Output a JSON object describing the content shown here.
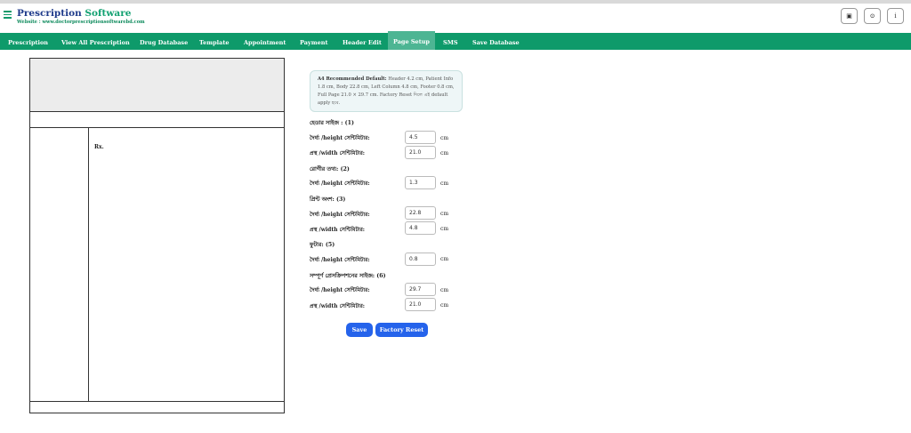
{
  "brand": {
    "name_part1": "Prescription",
    "name_part2": "Software",
    "website": "Website : www.doctorprescriptionsoftwarebd.com"
  },
  "header_buttons": [
    {
      "icon": "document-icon",
      "glyph": "▣"
    },
    {
      "icon": "help-icon",
      "glyph": "⊙"
    },
    {
      "icon": "user-icon",
      "glyph": "ⅰ"
    }
  ],
  "nav": {
    "items": [
      {
        "label": "Prescription"
      },
      {
        "label": "View All Prescription"
      },
      {
        "label": "Drug Database"
      },
      {
        "label": "Template"
      },
      {
        "label": "Appointment"
      },
      {
        "label": "Payment"
      },
      {
        "label": "Header Edit"
      },
      {
        "label": "Page Setup",
        "active": true
      },
      {
        "label": "SMS"
      },
      {
        "label": "Save Database"
      }
    ]
  },
  "preview": {
    "rx_label": "Rx."
  },
  "info": {
    "title": "A4 Recommended Default:",
    "text": "Header 4.2 cm, Patient Info 1.8 cm, Body 22.8 cm, Left Column 4.8 cm, Footer 0.8 cm, Full Page 21.0 × 29.7 cm. Factory Reset দিলে এই default apply হবে."
  },
  "form": {
    "unit": "cm",
    "sections": [
      {
        "title": "হেডার সাইজ : (1)",
        "fields": [
          {
            "label": "দৈর্ঘ্য /height সেন্টিমিটার:",
            "value": "4.5"
          },
          {
            "label": "প্রস্থ /width সেন্টিমিটার:",
            "value": "21.0"
          }
        ]
      },
      {
        "title": "রোগীর তথ্য: (2)",
        "fields": [
          {
            "label": "দৈর্ঘ্য /height সেন্টিমিটার:",
            "value": "1.3"
          }
        ]
      },
      {
        "title": "প্রিন্ট অংশ: (3)",
        "fields": [
          {
            "label": "দৈর্ঘ্য /height সেন্টিমিটার:",
            "value": "22.8"
          },
          {
            "label": "প্রস্থ /width সেন্টিমিটার:",
            "value": "4.8"
          }
        ]
      },
      {
        "title": "ফুটার: (5)",
        "fields": [
          {
            "label": "দৈর্ঘ্য /height সেন্টিমিটার:",
            "value": "0.8"
          }
        ]
      },
      {
        "title": "সম্পূর্ণ প্রেসক্রিপশনের সাইজ: (6)",
        "fields": [
          {
            "label": "দৈর্ঘ্য /height সেন্টিমিটার:",
            "value": "29.7"
          },
          {
            "label": "প্রস্থ /width সেন্টিমিটার:",
            "value": "21.0"
          }
        ]
      }
    ]
  },
  "actions": {
    "save": "Save",
    "factory_reset": "Factory Reset"
  },
  "colors": {
    "nav_bg": "#0e9a6a",
    "nav_active": "#4db593",
    "button": "#2563eb",
    "brand_dark": "#1e3a8a",
    "brand_green": "#10a070"
  }
}
